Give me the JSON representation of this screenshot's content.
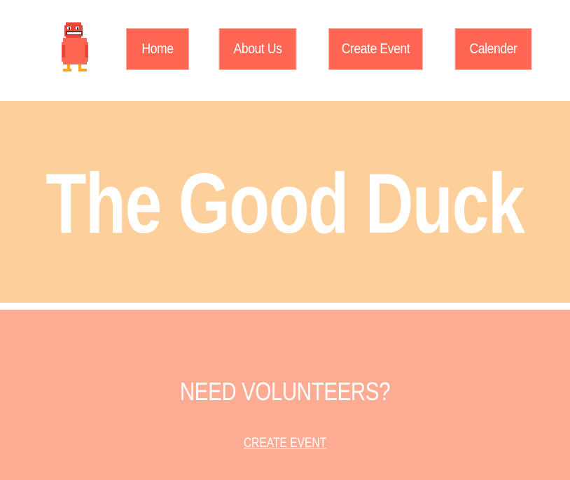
{
  "header": {
    "logo_icon": "pixel-duck-icon",
    "nav": [
      {
        "label": "Home"
      },
      {
        "label": "About Us"
      },
      {
        "label": "Create Event"
      },
      {
        "label": "Calender"
      }
    ]
  },
  "hero": {
    "title": "The Good Duck"
  },
  "volunteer": {
    "heading": "NEED VOLUNTEERS?",
    "link_label": "CREATE EVENT"
  },
  "colors": {
    "nav_button": "#ff6653",
    "hero_background": "#fdd09b",
    "volunteer_background": "#fdab93",
    "text": "#ffffff"
  }
}
